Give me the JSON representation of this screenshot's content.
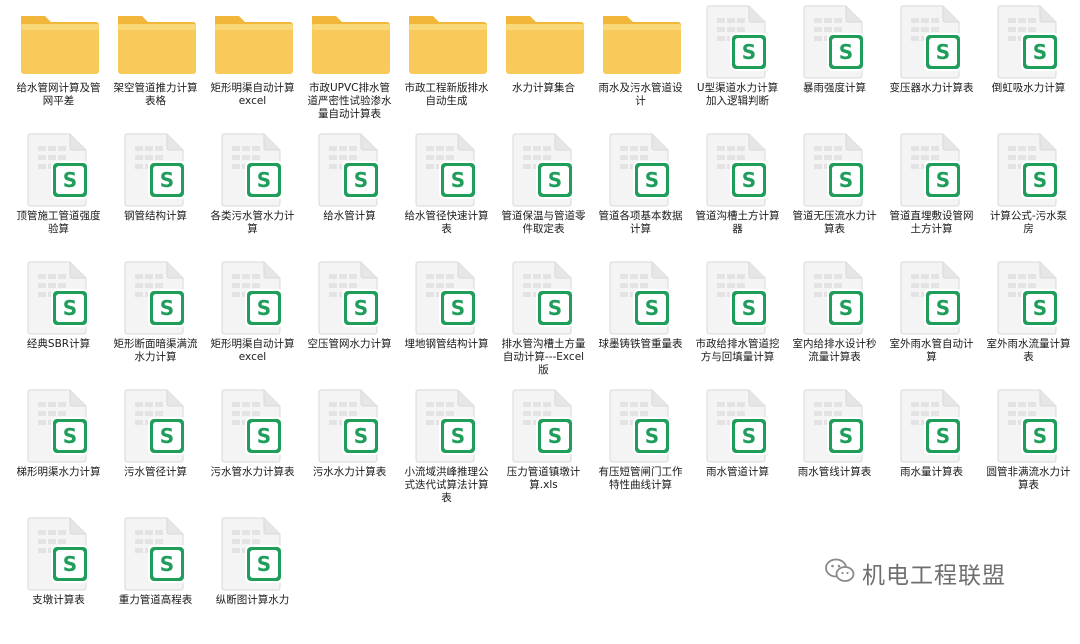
{
  "icons": {
    "folder": "folder-icon",
    "spreadsheet": "wps-spreadsheet-file-icon",
    "badge_letter": "S"
  },
  "colors": {
    "folder_body": "#f8ca5a",
    "folder_back": "#f2b63a",
    "badge_green": "#1f9d5b",
    "page": "#f4f4f4"
  },
  "items": [
    {
      "type": "folder",
      "label": "给水管网计算及管网平差"
    },
    {
      "type": "folder",
      "label": "架空管道推力计算表格"
    },
    {
      "type": "folder",
      "label": "矩形明渠自动计算excel"
    },
    {
      "type": "folder",
      "label": "市政UPVC排水管道严密性试验渗水量自动计算表"
    },
    {
      "type": "folder",
      "label": "市政工程新版排水自动生成"
    },
    {
      "type": "folder",
      "label": "水力计算集合"
    },
    {
      "type": "folder",
      "label": "雨水及污水管道设计"
    },
    {
      "type": "file",
      "label": "U型渠道水力计算加入逻辑判断"
    },
    {
      "type": "file",
      "label": "暴雨强度计算"
    },
    {
      "type": "file",
      "label": "变压器水力计算表"
    },
    {
      "type": "file",
      "label": "倒虹吸水力计算"
    },
    {
      "type": "file",
      "label": "顶管施工管道强度验算"
    },
    {
      "type": "file",
      "label": "钢管结构计算"
    },
    {
      "type": "file",
      "label": "各类污水管水力计算"
    },
    {
      "type": "file",
      "label": "给水管计算"
    },
    {
      "type": "file",
      "label": "给水管径快速计算表"
    },
    {
      "type": "file",
      "label": "管道保温与管道零件取定表"
    },
    {
      "type": "file",
      "label": "管道各项基本数据计算"
    },
    {
      "type": "file",
      "label": "管道沟槽土方计算器"
    },
    {
      "type": "file",
      "label": "管道无压流水力计算表"
    },
    {
      "type": "file",
      "label": "管道直埋敷设管网土方计算"
    },
    {
      "type": "file",
      "label": "计算公式-污水泵房"
    },
    {
      "type": "file",
      "label": "经典SBR计算"
    },
    {
      "type": "file",
      "label": "矩形断面暗渠满流水力计算"
    },
    {
      "type": "file",
      "label": "矩形明渠自动计算excel"
    },
    {
      "type": "file",
      "label": "空压管网水力计算"
    },
    {
      "type": "file",
      "label": "埋地钢管结构计算"
    },
    {
      "type": "file",
      "label": "排水管沟槽土方量自动计算---Excel版"
    },
    {
      "type": "file",
      "label": "球墨铸铁管重量表"
    },
    {
      "type": "file",
      "label": "市政给排水管道挖方与回填量计算"
    },
    {
      "type": "file",
      "label": "室内给排水设计秒流量计算表"
    },
    {
      "type": "file",
      "label": "室外雨水管自动计算"
    },
    {
      "type": "file",
      "label": "室外雨水流量计算表"
    },
    {
      "type": "file",
      "label": "梯形明渠水力计算"
    },
    {
      "type": "file",
      "label": "污水管径计算"
    },
    {
      "type": "file",
      "label": "污水管水力计算表"
    },
    {
      "type": "file",
      "label": "污水水力计算表"
    },
    {
      "type": "file",
      "label": "小流域洪峰推理公式迭代试算法计算表"
    },
    {
      "type": "file",
      "label": "压力管道镇墩计算.xls"
    },
    {
      "type": "file",
      "label": "有压短管闸门工作特性曲线计算"
    },
    {
      "type": "file",
      "label": "雨水管道计算"
    },
    {
      "type": "file",
      "label": "雨水管线计算表"
    },
    {
      "type": "file",
      "label": "雨水量计算表"
    },
    {
      "type": "file",
      "label": "圆管非满流水力计算表"
    },
    {
      "type": "file",
      "label": "支墩计算表"
    },
    {
      "type": "file",
      "label": "重力管道高程表"
    },
    {
      "type": "file",
      "label": "纵断图计算水力"
    }
  ],
  "watermark": {
    "text": "机电工程联盟",
    "icon": "wechat-icon"
  }
}
